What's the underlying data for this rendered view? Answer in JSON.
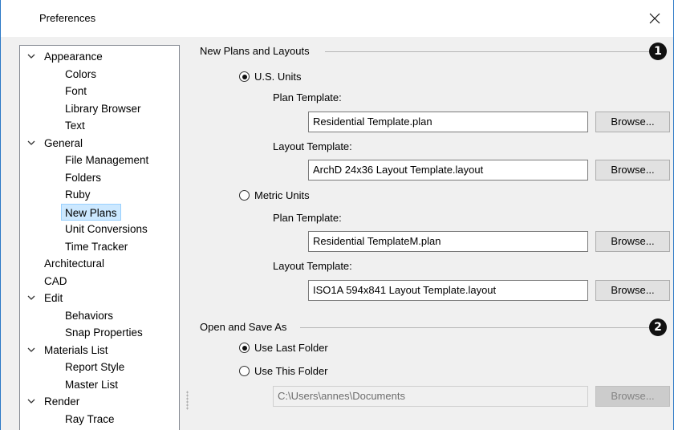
{
  "window": {
    "title": "Preferences",
    "close_glyph": "close-icon"
  },
  "tree": {
    "items": [
      {
        "label": "Appearance",
        "level": 0,
        "expanded": true
      },
      {
        "label": "Colors",
        "level": 1
      },
      {
        "label": "Font",
        "level": 1
      },
      {
        "label": "Library Browser",
        "level": 1
      },
      {
        "label": "Text",
        "level": 1
      },
      {
        "label": "General",
        "level": 0,
        "expanded": true
      },
      {
        "label": "File Management",
        "level": 1
      },
      {
        "label": "Folders",
        "level": 1
      },
      {
        "label": "Ruby",
        "level": 1
      },
      {
        "label": "New Plans",
        "level": 1,
        "selected": true
      },
      {
        "label": "Unit Conversions",
        "level": 1
      },
      {
        "label": "Time Tracker",
        "level": 1
      },
      {
        "label": "Architectural",
        "level": 0
      },
      {
        "label": "CAD",
        "level": 0
      },
      {
        "label": "Edit",
        "level": 0,
        "expanded": true
      },
      {
        "label": "Behaviors",
        "level": 1
      },
      {
        "label": "Snap Properties",
        "level": 1
      },
      {
        "label": "Materials List",
        "level": 0,
        "expanded": true
      },
      {
        "label": "Report Style",
        "level": 1
      },
      {
        "label": "Master List",
        "level": 1
      },
      {
        "label": "Render",
        "level": 0,
        "expanded": true
      },
      {
        "label": "Ray Trace",
        "level": 1
      }
    ]
  },
  "new_plans": {
    "title": "New Plans and Layouts",
    "badge": "1",
    "us": {
      "label": "U.S. Units",
      "selected": true,
      "plan_label": "Plan Template:",
      "plan_value": "Residential Template.plan",
      "layout_label": "Layout Template:",
      "layout_value": "ArchD 24x36 Layout Template.layout"
    },
    "metric": {
      "label": "Metric Units",
      "selected": false,
      "plan_label": "Plan Template:",
      "plan_value": "Residential TemplateM.plan",
      "layout_label": "Layout Template:",
      "layout_value": "ISO1A 594x841 Layout Template.layout"
    },
    "browse": "Browse..."
  },
  "open_save": {
    "title": "Open and Save As",
    "badge": "2",
    "last_folder": "Use Last Folder",
    "last_selected": true,
    "this_folder": "Use This Folder",
    "folder_value": "C:\\Users\\annes\\Documents",
    "browse": "Browse..."
  },
  "colors": {
    "accent_border": "#2b78c6",
    "selection": "#cce8ff"
  }
}
